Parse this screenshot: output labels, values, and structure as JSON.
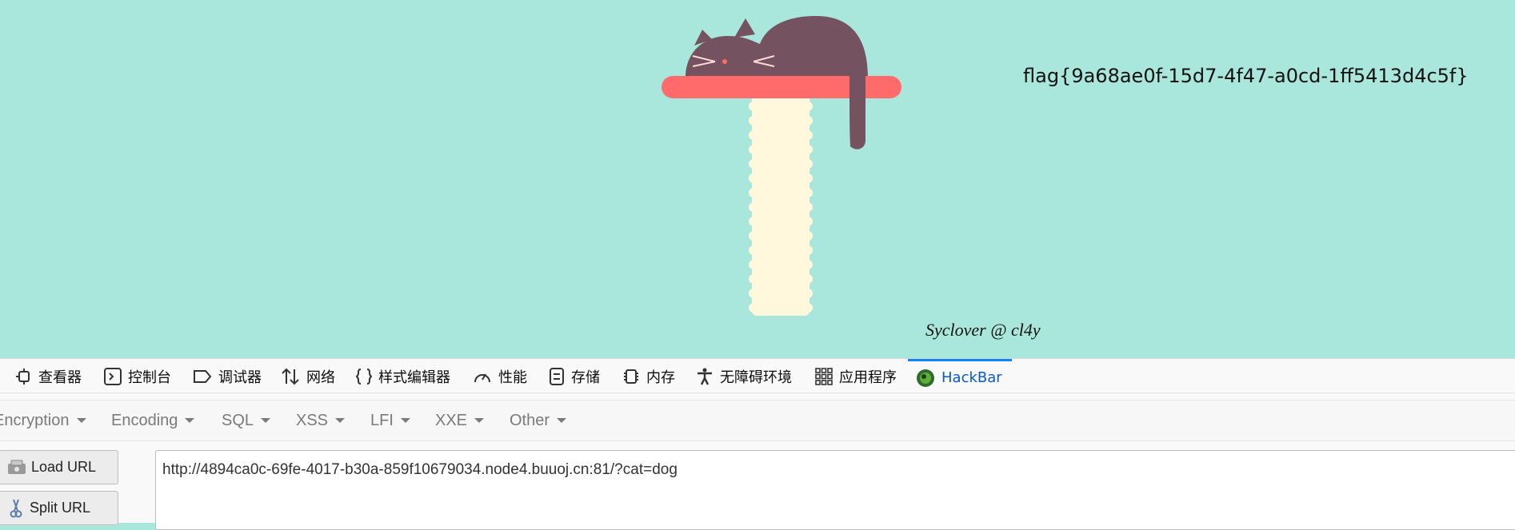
{
  "page": {
    "flag_text": "flag{9a68ae0f-15d7-4f47-a0cd-1ff5413d4c5f}",
    "signature": "Syclover @ cl4y"
  },
  "devtools": {
    "tabs": [
      {
        "label": "查看器",
        "icon": "inspector-icon"
      },
      {
        "label": "控制台",
        "icon": "console-icon"
      },
      {
        "label": "调试器",
        "icon": "debugger-icon"
      },
      {
        "label": "网络",
        "icon": "network-icon"
      },
      {
        "label": "样式编辑器",
        "icon": "style-editor-icon"
      },
      {
        "label": "性能",
        "icon": "performance-icon"
      },
      {
        "label": "存储",
        "icon": "storage-icon"
      },
      {
        "label": "内存",
        "icon": "memory-icon"
      },
      {
        "label": "无障碍环境",
        "icon": "accessibility-icon"
      },
      {
        "label": "应用程序",
        "icon": "application-icon"
      },
      {
        "label": "HackBar",
        "icon": "hackbar-icon",
        "active": true
      }
    ]
  },
  "hackbar": {
    "menus": [
      "Encryption",
      "Encoding",
      "SQL",
      "XSS",
      "LFI",
      "XXE",
      "Other"
    ],
    "load_url_label": "Load URL",
    "split_url_label": "Split URL",
    "url_value": "http://4894ca0c-69fe-4017-b30a-859f10679034.node4.buuoj.cn:81/?cat=dog"
  },
  "colors": {
    "background": "#a9e7dc",
    "cat": "#74525f",
    "shelf": "#ff6b6b",
    "post": "#fff8dc",
    "active_tab": "#0a84ff"
  }
}
